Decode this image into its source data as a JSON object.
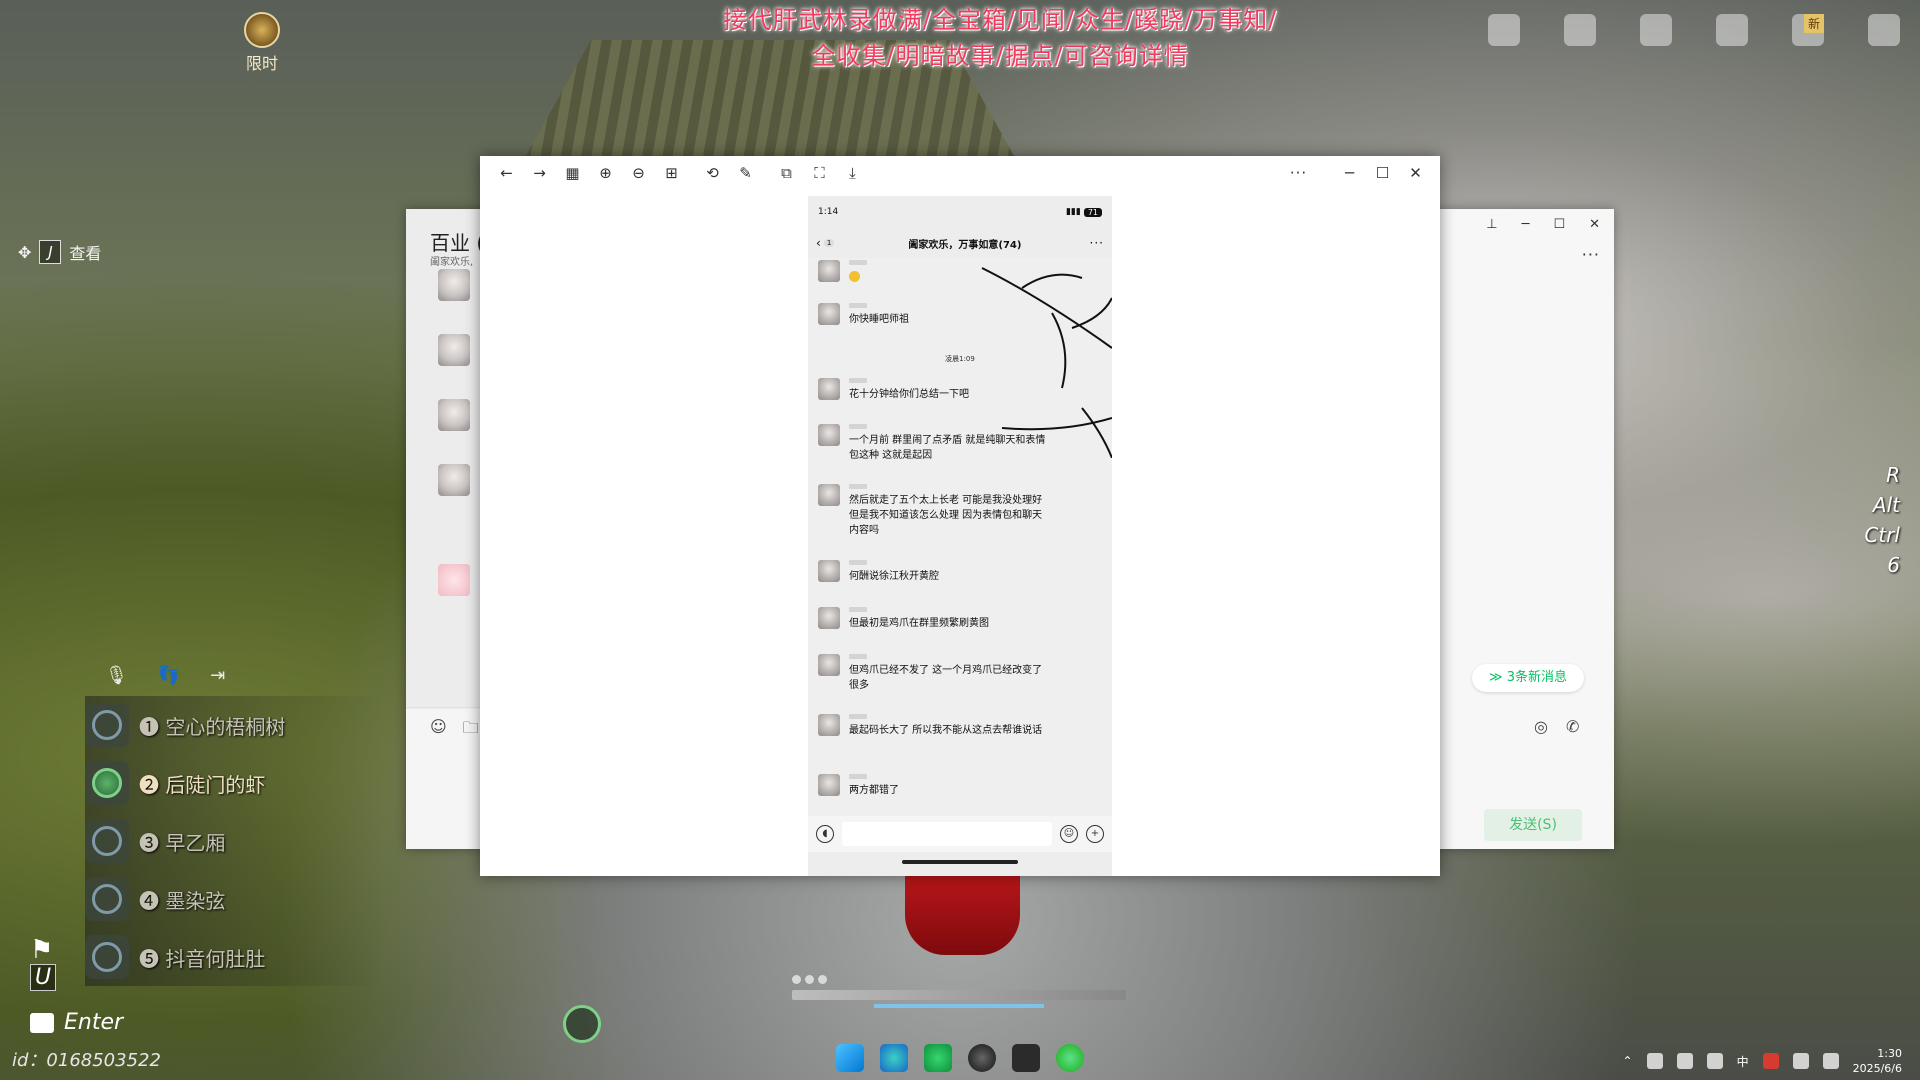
{
  "game": {
    "promo_text": "接代肝武林录做满/全宝箱/见闻/众生/蹊跷/万事知/\n全收集/明暗故事/据点/可咨询详情",
    "compass_label": "限时",
    "view_key": "J",
    "view_label": "查看",
    "new_badge": "新",
    "team_members": [
      {
        "num": "❶",
        "name": "空心的梧桐树"
      },
      {
        "num": "❷",
        "name": "后陡门的虾"
      },
      {
        "num": "❸",
        "name": "早乙厢"
      },
      {
        "num": "❹",
        "name": "墨染弦"
      },
      {
        "num": "❺",
        "name": "抖音何肚肚"
      }
    ],
    "flag_key": "U",
    "chat_key": "Enter",
    "player_id": "id：0168503522",
    "key_hints": [
      "R",
      "Alt",
      "Ctrl",
      "6"
    ]
  },
  "bg_chat": {
    "title": "百业 (",
    "subtitle": "阖家欢乐,",
    "new_messages": "≫ 3条新消息",
    "send_label": "发送(S)",
    "more": "···"
  },
  "viewer": {
    "toolbar_icons": [
      "arrow-left-icon",
      "arrow-right-icon",
      "grid-icon",
      "zoom-in-icon",
      "zoom-out-icon",
      "actual-size-icon",
      "rotate-icon",
      "edit-icon",
      "copy-icon",
      "screenshot-icon",
      "download-icon"
    ],
    "more": "···"
  },
  "phone": {
    "time": "1:14",
    "battery": "71",
    "unread": "1",
    "chat_title": "阖家欢乐，万事如意(74)",
    "timestamp": "凌晨1:09",
    "messages": [
      {
        "text": "",
        "emoji": true
      },
      {
        "text": "你快睡吧师祖"
      },
      {
        "text": "花十分钟给你们总结一下吧"
      },
      {
        "text": "一个月前 群里闹了点矛盾 就是纯聊天和表情包这种 这就是起因"
      },
      {
        "text": "然后就走了五个太上长老 可能是我没处理好 但是我不知道该怎么处理 因为表情包和聊天内容吗"
      },
      {
        "text": "何酬说徐江秋开黄腔"
      },
      {
        "text": "但最初是鸡爪在群里频繁刷黄图"
      },
      {
        "text": "但鸡爪已经不发了 这一个月鸡爪已经改变了很多"
      },
      {
        "text": "最起码长大了 所以我不能从这点去帮谁说话"
      },
      {
        "text": "两方都错了"
      }
    ]
  },
  "taskbar": {
    "time": "1:30",
    "date": "2025/6/6",
    "ime": "中"
  }
}
